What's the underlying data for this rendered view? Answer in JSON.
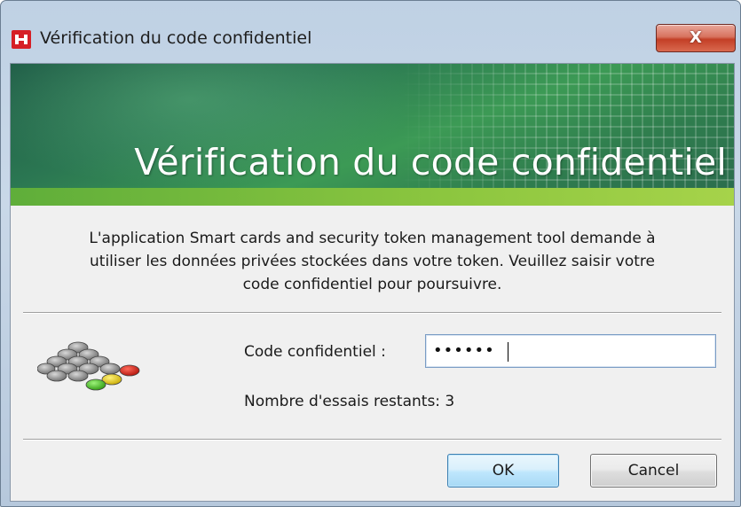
{
  "window": {
    "title": "Vérification du code confidentiel",
    "close_label": "X"
  },
  "banner": {
    "title": "Vérification du code confidentiel"
  },
  "description": {
    "lines": [
      "L'application Smart cards and security token management tool demande à",
      "utiliser les données privées stockées dans votre token. Veuillez saisir votre",
      "code confidentiel pour poursuivre."
    ]
  },
  "pin": {
    "label": "Code confidentiel :",
    "masked_value": "••••••",
    "tries_text": "Nombre d'essais restants: 3"
  },
  "buttons": {
    "ok": "OK",
    "cancel": "Cancel"
  },
  "icons": {
    "app": "app-logo-icon",
    "tokens": "token-cluster-icon",
    "close": "close-icon"
  },
  "colors": {
    "banner_green": "#2b7752",
    "close_red": "#c33f26",
    "ok_blue": "#3c7fb1"
  }
}
